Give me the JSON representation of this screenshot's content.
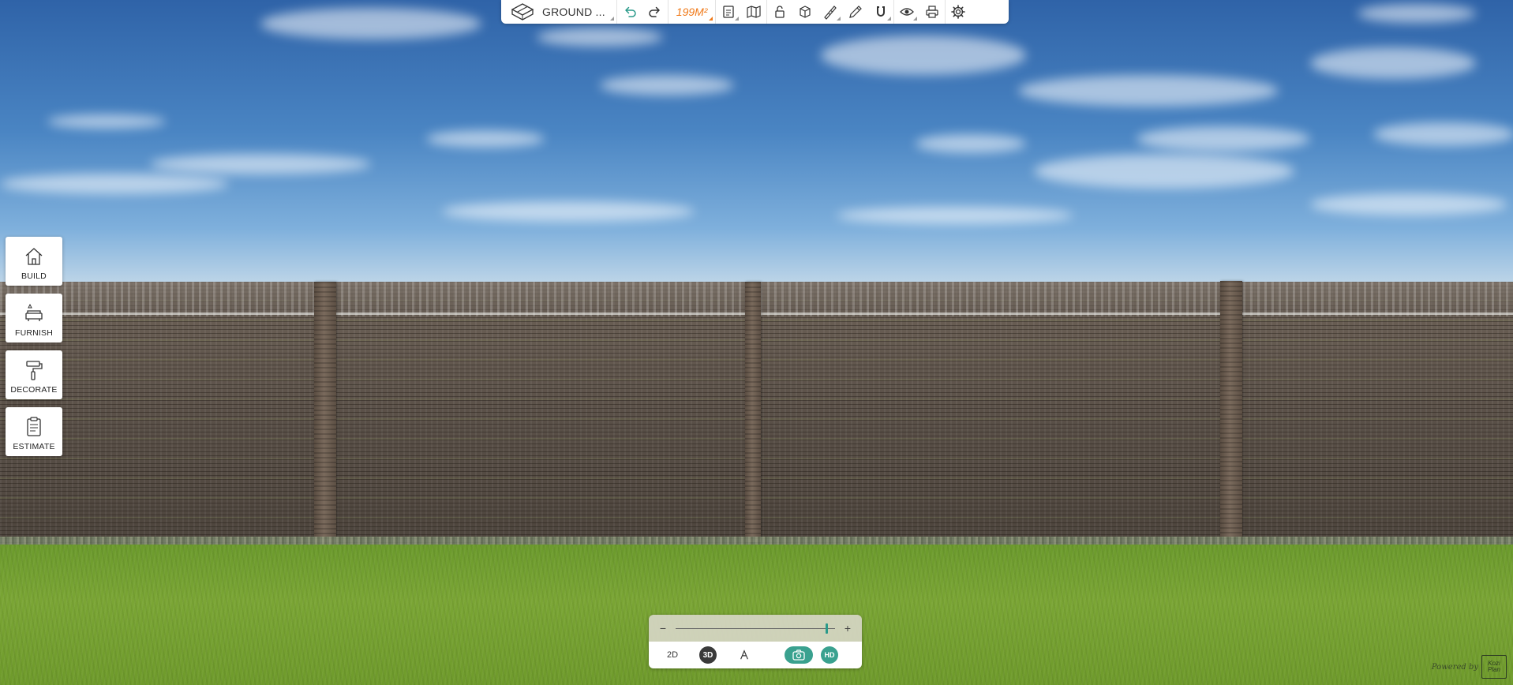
{
  "toolbar": {
    "floor_label": "GROUND ...",
    "area_label": "199M²",
    "icons": [
      "floor-icon",
      "undo-icon",
      "redo-icon",
      "document-icon",
      "map-icon",
      "lock-icon",
      "cube-icon",
      "ruler-icon",
      "eyedropper-icon",
      "magnet-icon",
      "eye-icon",
      "print-icon",
      "gear-icon"
    ]
  },
  "sidebar": {
    "items": [
      {
        "label": "BUILD",
        "icon": "house-icon"
      },
      {
        "label": "FURNISH",
        "icon": "sofa-icon"
      },
      {
        "label": "DECORATE",
        "icon": "paint-roller-icon"
      },
      {
        "label": "ESTIMATE",
        "icon": "clipboard-icon"
      }
    ]
  },
  "view_panel": {
    "zoom_minus": "−",
    "zoom_plus": "+",
    "zoom_level": 0.94,
    "mode_2d": "2D",
    "mode_3d": "3D",
    "hd_label": "HD"
  },
  "footer": {
    "powered_by": "Powered by",
    "logo_text": "Kozi Plan"
  },
  "colors": {
    "accent_orange": "#f07a1a",
    "accent_teal": "#3aa18f",
    "sky": "#4a85c3",
    "grass": "#7aa534"
  }
}
